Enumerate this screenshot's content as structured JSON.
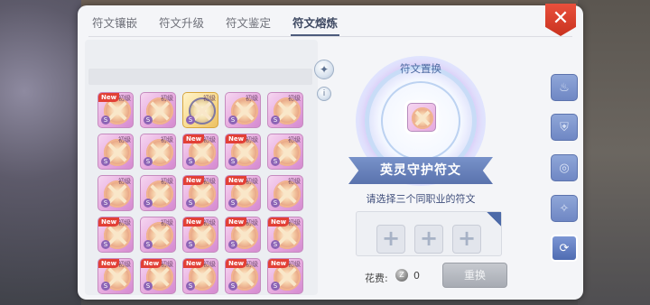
{
  "tabs": [
    {
      "label": "符文镶嵌"
    },
    {
      "label": "符文升级"
    },
    {
      "label": "符文鉴定"
    },
    {
      "label": "符文熔炼"
    }
  ],
  "active_tab": "符文熔炼",
  "close_icon": "close-x-icon",
  "grid": {
    "badge_new": "New",
    "cell_label": "初级",
    "s_mark": "S"
  },
  "replace": {
    "title": "符文置换",
    "rune_name": "英灵守护符文",
    "hint": "请选择三个同职业的符文",
    "slot_symbol": "+",
    "cost_label": "花费:",
    "cost_value": "0",
    "reset_label": "重换"
  },
  "colors": {
    "accent": "#4d5b7c",
    "ribbon": "#5a72ad",
    "close": "#d63a27",
    "new_badge": "#e24036"
  }
}
